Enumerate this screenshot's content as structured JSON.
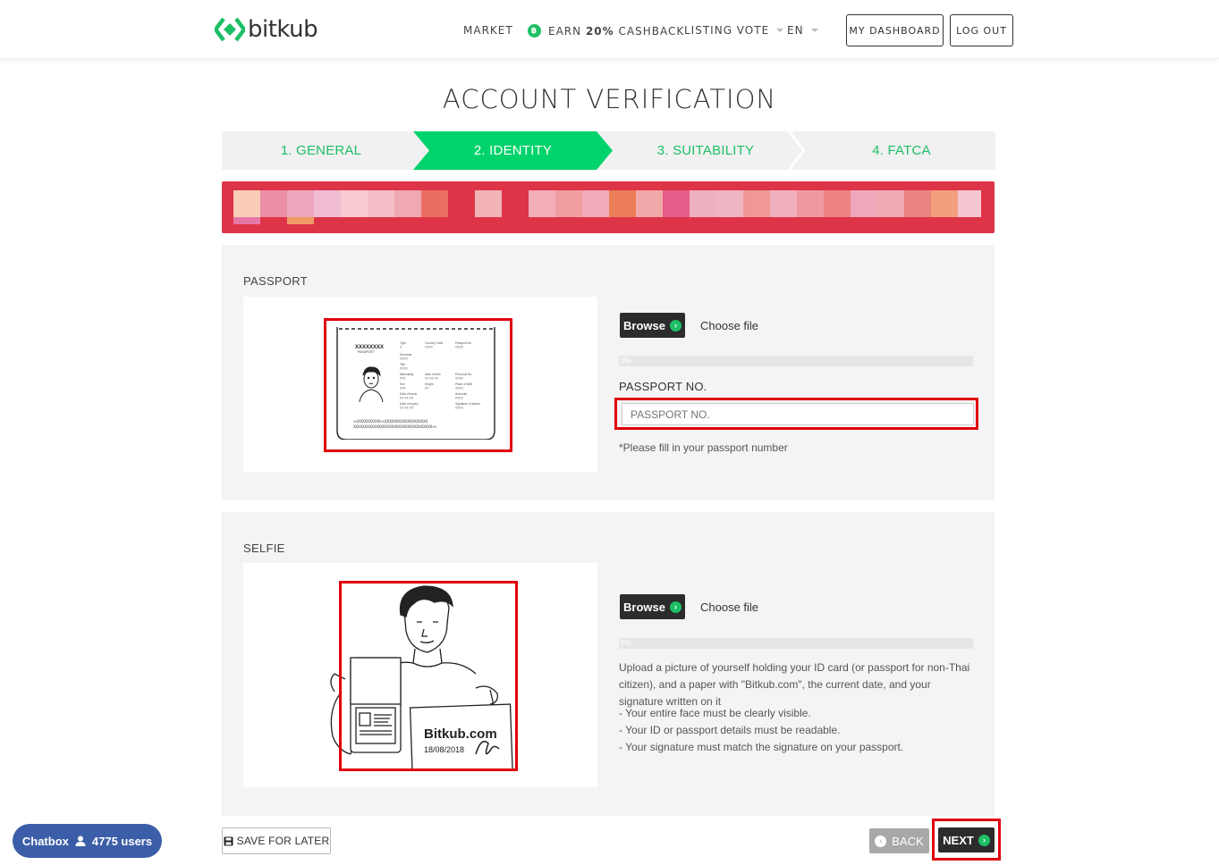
{
  "header": {
    "logo_text": "bitkub",
    "nav": {
      "market": "MARKET",
      "earn_prefix": "EARN",
      "earn_percent": "20%",
      "earn_suffix": "CASHBACK",
      "listing_vote": "LISTING VOTE",
      "language": "EN"
    },
    "buttons": {
      "dashboard": "MY DASHBOARD",
      "logout": "LOG OUT"
    }
  },
  "page_title": "ACCOUNT VERIFICATION",
  "steps": [
    {
      "label": "1. GENERAL",
      "active": false
    },
    {
      "label": "2. IDENTITY",
      "active": true
    },
    {
      "label": "3. SUITABILITY",
      "active": false
    },
    {
      "label": "4. FATCA",
      "active": false
    }
  ],
  "passport": {
    "section_label": "PASSPORT",
    "browse_label": "Browse",
    "choose_file": "Choose file",
    "progress_text": "0%",
    "progress": 0,
    "field_label": "PASSPORT NO.",
    "field_placeholder": "PASSPORT NO.",
    "hint": "*Please fill in your passport number"
  },
  "selfie": {
    "section_label": "SELFIE",
    "browse_label": "Browse",
    "choose_file": "Choose file",
    "progress_text": "0%",
    "progress": 0,
    "description": "Upload a picture of yourself holding your ID card (or passport for non-Thai citizen), and a paper with \"Bitkub.com\", the current date, and your signature written on it",
    "rules": [
      "- Your entire face must be clearly visible.",
      "- Your ID or passport details must be readable.",
      "- Your signature must match the signature on your passport."
    ],
    "paper_text": "Bitkub.com",
    "paper_date": "18/08/2018"
  },
  "footer": {
    "save_label": "SAVE FOR LATER",
    "back_label": "BACK",
    "next_label": "NEXT"
  },
  "chatbox": {
    "label": "Chatbox",
    "users": "4775 users"
  },
  "colors": {
    "brand_green": "#00d36b",
    "alert_red": "#de3448",
    "highlight_red": "#e0000d",
    "dark_button": "#2c2c2c",
    "chat_blue": "#3c5ea8"
  }
}
